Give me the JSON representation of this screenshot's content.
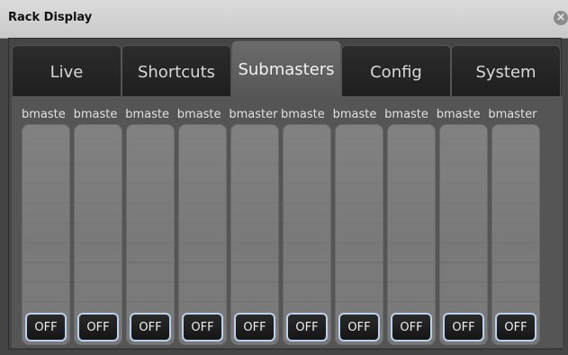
{
  "window": {
    "title": "Rack Display"
  },
  "tabs": [
    {
      "label": "Live"
    },
    {
      "label": "Shortcuts"
    },
    {
      "label": "Submasters"
    },
    {
      "label": "Config"
    },
    {
      "label": "System"
    }
  ],
  "faders": [
    {
      "label": "bmaste",
      "button": "OFF"
    },
    {
      "label": "bmaste",
      "button": "OFF"
    },
    {
      "label": "bmaste",
      "button": "OFF"
    },
    {
      "label": "bmaste",
      "button": "OFF"
    },
    {
      "label": "bmaster",
      "button": "OFF"
    },
    {
      "label": "bmaste",
      "button": "OFF"
    },
    {
      "label": "bmaste",
      "button": "OFF"
    },
    {
      "label": "bmaste",
      "button": "OFF"
    },
    {
      "label": "bmaste",
      "button": "OFF"
    },
    {
      "label": "bmaster",
      "button": "OFF"
    }
  ]
}
